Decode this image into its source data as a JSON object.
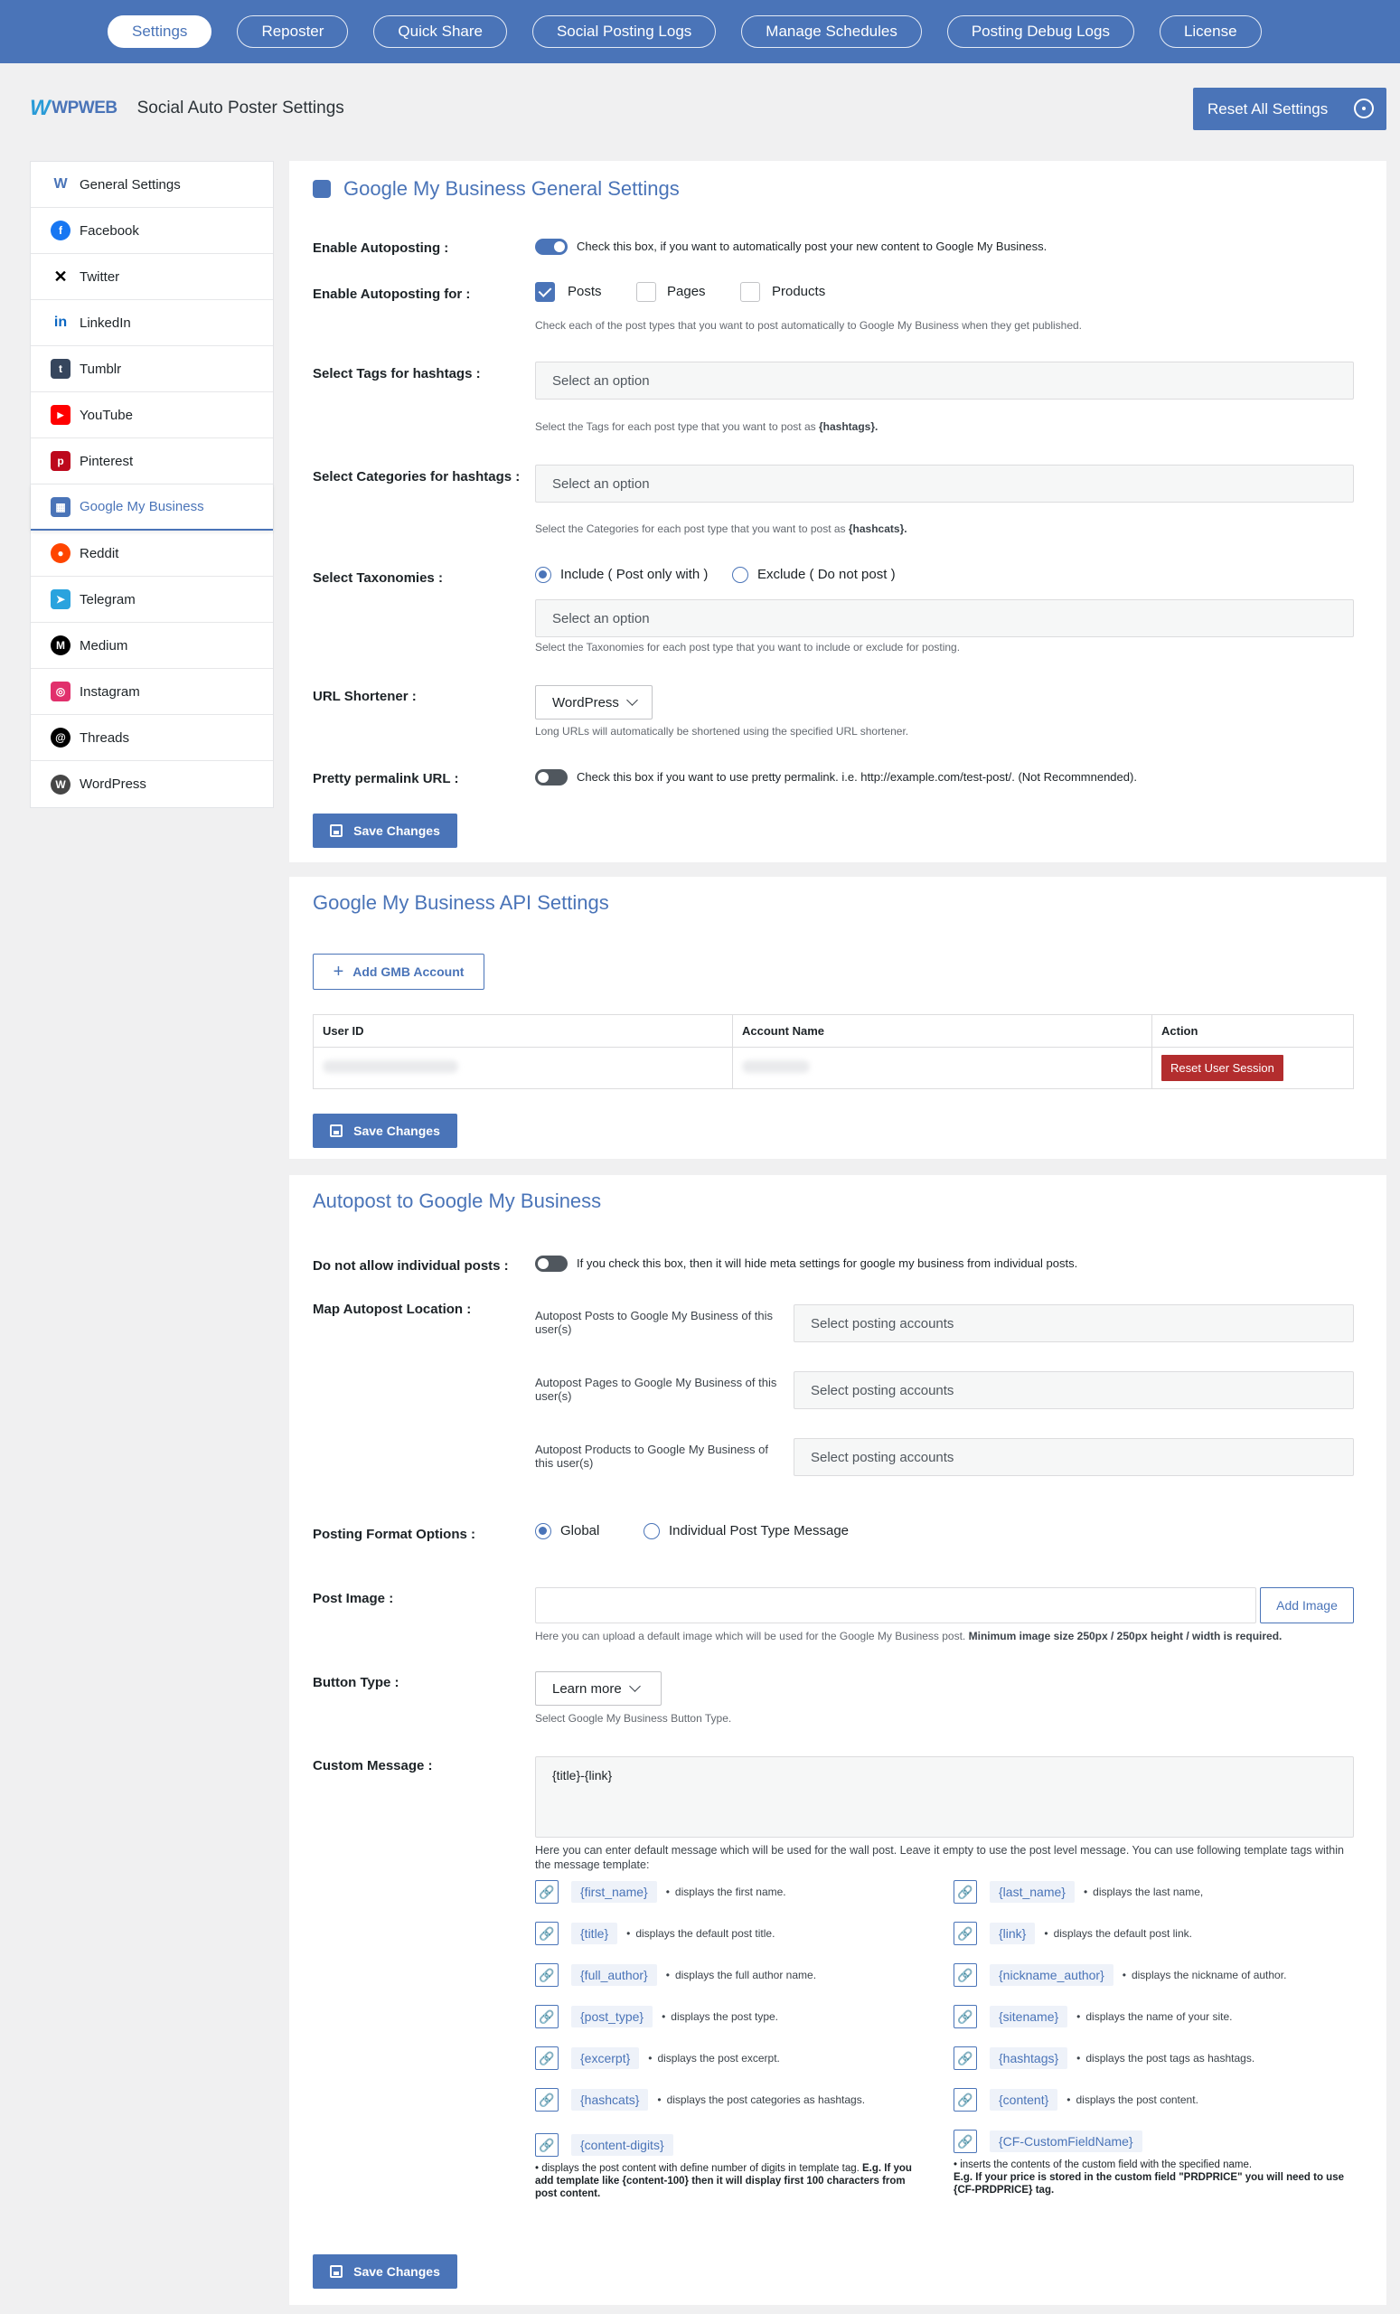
{
  "nav": {
    "tabs": [
      "Settings",
      "Reposter",
      "Quick Share",
      "Social Posting Logs",
      "Manage Schedules",
      "Posting Debug Logs",
      "License"
    ]
  },
  "header": {
    "logo_text": "WPWEB",
    "title": "Social Auto Poster Settings",
    "reset_all_label": "Reset All Settings"
  },
  "sidebar": {
    "items": [
      {
        "label": "General Settings",
        "icon": "wpweb-icon",
        "color": "#4a74b8"
      },
      {
        "label": "Facebook",
        "icon": "facebook-icon",
        "color": "#1877f2"
      },
      {
        "label": "Twitter",
        "icon": "x-twitter-icon",
        "color": "#000000"
      },
      {
        "label": "LinkedIn",
        "icon": "linkedin-icon",
        "color": "#0a66c2"
      },
      {
        "label": "Tumblr",
        "icon": "tumblr-icon",
        "color": "#36465d"
      },
      {
        "label": "YouTube",
        "icon": "youtube-icon",
        "color": "#ff0000"
      },
      {
        "label": "Pinterest",
        "icon": "pinterest-icon",
        "color": "#bd081c"
      },
      {
        "label": "Google My Business",
        "icon": "google-my-business-icon",
        "color": "#4a74b8"
      },
      {
        "label": "Reddit",
        "icon": "reddit-icon",
        "color": "#ff4500"
      },
      {
        "label": "Telegram",
        "icon": "telegram-icon",
        "color": "#2aa3de"
      },
      {
        "label": "Medium",
        "icon": "medium-icon",
        "color": "#000000"
      },
      {
        "label": "Instagram",
        "icon": "instagram-icon",
        "color": "#e1306c"
      },
      {
        "label": "Threads",
        "icon": "threads-icon",
        "color": "#000000"
      },
      {
        "label": "WordPress",
        "icon": "wordpress-icon",
        "color": "#464646"
      }
    ],
    "active_index": 7
  },
  "general": {
    "title": "Google My Business General Settings",
    "enable_autoposting_label": "Enable Autoposting :",
    "enable_autoposting_help": "Check this box, if you want to automatically post your new content to Google My Business.",
    "enable_for_label": "Enable Autoposting for :",
    "post_types": [
      {
        "label": "Posts",
        "checked": true
      },
      {
        "label": "Pages",
        "checked": false
      },
      {
        "label": "Products",
        "checked": false
      }
    ],
    "enable_for_help": "Check each of the post types that you want to post automatically to Google My Business when they get published.",
    "tags_label": "Select Tags for hashtags :",
    "tags_placeholder": "Select an option",
    "tags_help_pre": "Select the Tags for each post type that you want to post as ",
    "tags_help_bold": "{hashtags}.",
    "cats_label": "Select Categories for hashtags :",
    "cats_placeholder": "Select an option",
    "cats_help_pre": "Select the Categories for each post type that you want to post as ",
    "cats_help_bold": "{hashcats}.",
    "tax_label": "Select Taxonomies :",
    "tax_include": "Include ( Post only with )",
    "tax_exclude": "Exclude ( Do not post )",
    "tax_placeholder": "Select an option",
    "tax_help": "Select the Taxonomies for each post type that you want to include or exclude for posting.",
    "shortener_label": "URL Shortener :",
    "shortener_value": "WordPress",
    "shortener_help": "Long URLs will automatically be shortened using the specified URL shortener.",
    "permalink_label": "Pretty permalink URL :",
    "permalink_help": "Check this box if you want to use pretty permalink. i.e. http://example.com/test-post/. (Not Recommnended).",
    "save_label": "Save Changes"
  },
  "api": {
    "title": "Google My Business API Settings",
    "add_account_label": "Add GMB Account",
    "columns": [
      "User ID",
      "Account Name",
      "Action"
    ],
    "reset_session_label": "Reset User Session",
    "save_label": "Save Changes"
  },
  "autopost": {
    "title": "Autopost to Google My Business",
    "individual_label": "Do not allow individual posts :",
    "individual_help": "If you check this box, then it will hide meta settings for google my business from individual posts.",
    "map_label": "Map Autopost Location :",
    "map_rows": [
      {
        "label": "Autopost Posts to Google My Business of this user(s)",
        "placeholder": "Select posting accounts"
      },
      {
        "label": "Autopost Pages to Google My Business of this user(s)",
        "placeholder": "Select posting accounts"
      },
      {
        "label": "Autopost Products to Google My Business of this user(s)",
        "placeholder": "Select posting accounts"
      }
    ],
    "format_label": "Posting Format Options :",
    "format_global": "Global",
    "format_individual": "Individual Post Type Message",
    "image_label": "Post Image :",
    "add_image_label": "Add Image",
    "image_help_pre": "Here you can upload a default image which will be used for the Google My Business post. ",
    "image_help_bold": "Minimum image size 250px / 250px height / width is required.",
    "button_type_label": "Button Type :",
    "button_type_value": "Learn more",
    "button_type_help": "Select Google My Business Button Type.",
    "message_label": "Custom Message :",
    "message_value": "{title}-{link}",
    "message_help": "Here you can enter default message which will be used for the wall post. Leave it empty to use the post level message. You can use following template tags within the message template:",
    "tags_left": [
      {
        "tag": "{first_name}",
        "desc": "displays the first name."
      },
      {
        "tag": "{title}",
        "desc": "displays the default post title."
      },
      {
        "tag": "{full_author}",
        "desc": "displays the full author name."
      },
      {
        "tag": "{post_type}",
        "desc": "displays the post type."
      },
      {
        "tag": "{excerpt}",
        "desc": "displays the post excerpt."
      },
      {
        "tag": "{hashcats}",
        "desc": "displays the post categories as hashtags."
      }
    ],
    "tags_right": [
      {
        "tag": "{last_name}",
        "desc": "displays the last name,"
      },
      {
        "tag": "{link}",
        "desc": "displays the default post link."
      },
      {
        "tag": "{nickname_author}",
        "desc": "displays the nickname of author."
      },
      {
        "tag": "{sitename}",
        "desc": "displays the name of your site."
      },
      {
        "tag": "{hashtags}",
        "desc": "displays the post tags as hashtags."
      },
      {
        "tag": "{content}",
        "desc": "displays the post content."
      }
    ],
    "content_digits_tag": "{content-digits}",
    "content_digits_desc_pre": "• displays the post content with define number of digits in template tag. ",
    "content_digits_desc_bold": "E.g. If you add template like {content-100} then it will display first 100 characters from post content.",
    "cf_tag": "{CF-CustomFieldName}",
    "cf_desc": "• inserts the contents of the custom field with the specified name.",
    "cf_desc_bold": "E.g. If your price is stored in the custom field \"PRDPRICE\" you will need to use {CF-PRDPRICE} tag.",
    "save_label": "Save Changes"
  }
}
